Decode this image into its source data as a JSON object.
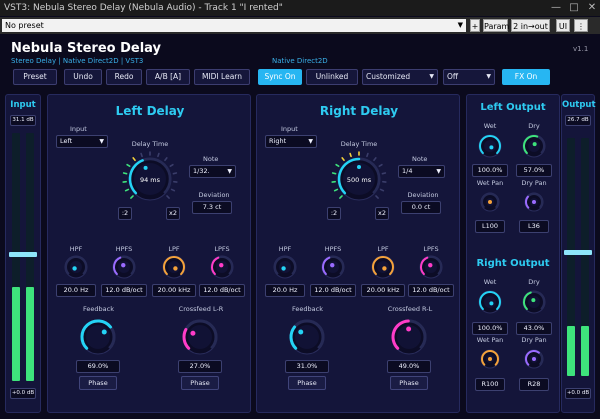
{
  "window": {
    "title": "VST3: Nebula Stereo Delay (Nebula Audio) - Track 1 \"I rented\""
  },
  "host": {
    "preset": "No preset",
    "plus": "+",
    "param": "Param",
    "io": "2 in→out",
    "ui": "UI"
  },
  "plugin": {
    "title": "Nebula Stereo Delay",
    "subtitle": "Stereo Delay | Native Direct2D | VST3",
    "version": "v1.1",
    "renderer": "Native Direct2D"
  },
  "toolbar": {
    "preset": "Preset",
    "undo": "Undo",
    "redo": "Redo",
    "ab": "A/B [A]",
    "midi": "MIDI Learn",
    "sync": "Sync On",
    "link": "Unlinked",
    "mode": "Customized",
    "fx_mode": "Off",
    "fx": "FX On"
  },
  "input": {
    "title": "Input",
    "top": "31.1 dB",
    "bottom": "+0.0 dB",
    "level_l": 0.38,
    "level_r": 0.38
  },
  "output": {
    "title": "Output",
    "top": "26.7 dB",
    "bottom": "+0.0 dB",
    "level_l": 0.21,
    "level_r": 0.21
  },
  "left": {
    "title": "Left Delay",
    "input_label": "Input",
    "input": "Left",
    "delay_label": "Delay Time",
    "delay": "94 ms",
    "delay_frac": 0.42,
    "div2": ":2",
    "mul2": "x2",
    "note_label": "Note",
    "note": "1/32.",
    "dev_label": "Deviation",
    "dev": "7.3 ct",
    "hpf_label": "HPF",
    "hpf": "20.0 Hz",
    "hpfs_label": "HPFS",
    "hpfs": "12.0 dB/oct",
    "lpf_label": "LPF",
    "lpf": "20.00 kHz",
    "lpfs_label": "LPFS",
    "lpfs": "12.0 dB/oct",
    "fb_label": "Feedback",
    "fb": "69.0%",
    "fb_frac": 0.69,
    "xf_label": "Crossfeed L-R",
    "xf": "27.0%",
    "xf_frac": 0.27,
    "phase": "Phase"
  },
  "right": {
    "title": "Right Delay",
    "input_label": "Input",
    "input": "Right",
    "delay_label": "Delay Time",
    "delay": "500 ms",
    "delay_frac": 0.5,
    "div2": ":2",
    "mul2": "x2",
    "note_label": "Note",
    "note": "1/4",
    "dev_label": "Deviation",
    "dev": "0.0 ct",
    "hpf_label": "HPF",
    "hpf": "20.0 Hz",
    "hpfs_label": "HPFS",
    "hpfs": "12.0 dB/oct",
    "lpf_label": "LPF",
    "lpf": "20.00 kHz",
    "lpfs_label": "LPFS",
    "lpfs": "12.0 dB/oct",
    "fb_label": "Feedback",
    "fb": "31.0%",
    "fb_frac": 0.31,
    "xf_label": "Crossfeed R-L",
    "xf": "49.0%",
    "xf_frac": 0.49,
    "phase": "Phase"
  },
  "left_out": {
    "title": "Left Output",
    "wet_label": "Wet",
    "wet": "100.0%",
    "dry_label": "Dry",
    "dry": "57.0%",
    "wetpan_label": "Wet Pan",
    "wetpan": "L100",
    "drypan_label": "Dry Pan",
    "drypan": "L36"
  },
  "right_out": {
    "title": "Right Output",
    "wet_label": "Wet",
    "wet": "100.0%",
    "dry_label": "Dry",
    "dry": "43.0%",
    "wetpan_label": "Wet Pan",
    "wetpan": "R100",
    "drypan_label": "Dry Pan",
    "drypan": "R28"
  },
  "colors": {
    "accent": "#2ecbf1",
    "cyan": "#24d3f5",
    "purple": "#9a6bff",
    "orange": "#f5a23a",
    "pink": "#ff3cc8",
    "green": "#3ee37c",
    "bg": "#0b0a1d",
    "panel": "#14153a"
  }
}
